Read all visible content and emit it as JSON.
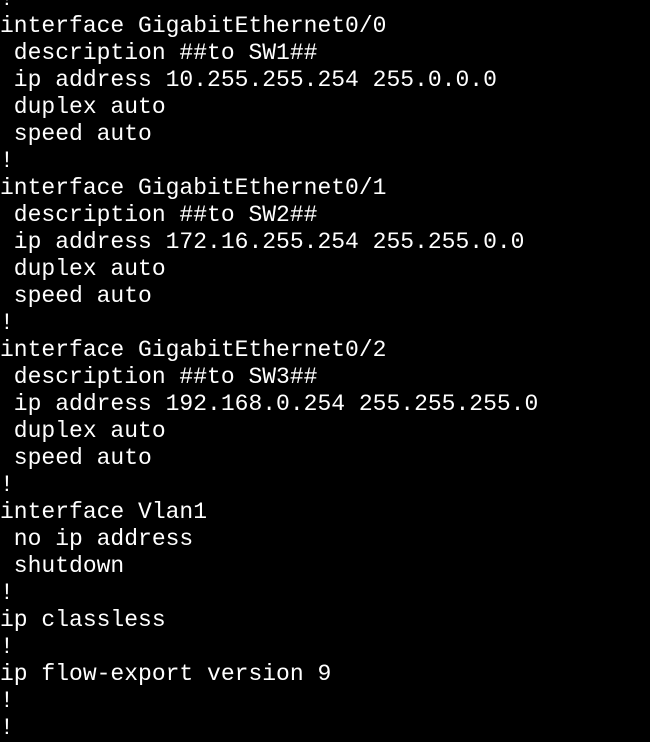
{
  "terminal": {
    "lines": [
      "!",
      "interface GigabitEthernet0/0",
      " description ##to SW1##",
      " ip address 10.255.255.254 255.0.0.0",
      " duplex auto",
      " speed auto",
      "!",
      "interface GigabitEthernet0/1",
      " description ##to SW2##",
      " ip address 172.16.255.254 255.255.0.0",
      " duplex auto",
      " speed auto",
      "!",
      "interface GigabitEthernet0/2",
      " description ##to SW3##",
      " ip address 192.168.0.254 255.255.255.0",
      " duplex auto",
      " speed auto",
      "!",
      "interface Vlan1",
      " no ip address",
      " shutdown",
      "!",
      "ip classless",
      "!",
      "ip flow-export version 9",
      "!",
      "!"
    ],
    "colors": {
      "background": "#000000",
      "text": "#ffffff"
    }
  }
}
